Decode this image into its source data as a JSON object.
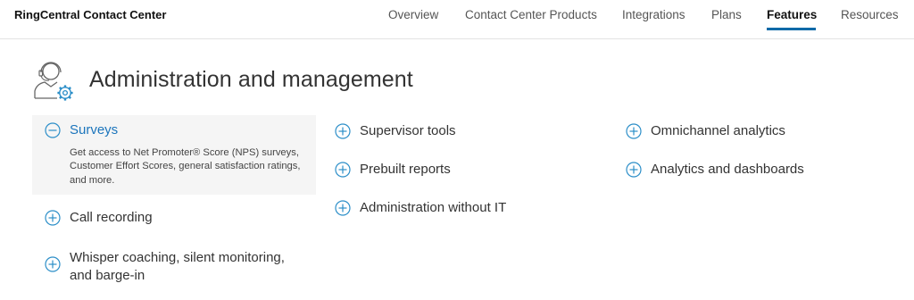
{
  "nav": {
    "brand": "RingCentral Contact Center",
    "links": [
      {
        "label": "Overview"
      },
      {
        "label": "Contact Center Products"
      },
      {
        "label": "Integrations"
      },
      {
        "label": "Plans"
      },
      {
        "label": "Features"
      },
      {
        "label": "Resources"
      }
    ],
    "active": "Features"
  },
  "section": {
    "icon": "agent-headset-gear-icon",
    "title": "Administration and management"
  },
  "columns": [
    {
      "items": [
        {
          "label": "Surveys",
          "expanded": true,
          "icon": "minus-circle-icon",
          "description": "Get access to Net Promoter® Score (NPS) surveys, Customer Effort Scores, general satisfaction ratings, and more."
        },
        {
          "label": "Call recording",
          "expanded": false,
          "icon": "plus-circle-icon"
        },
        {
          "label": "Whisper coaching, silent monitoring, and barge-in",
          "expanded": false,
          "icon": "plus-circle-icon"
        }
      ]
    },
    {
      "items": [
        {
          "label": "Supervisor tools",
          "expanded": false,
          "icon": "plus-circle-icon"
        },
        {
          "label": "Prebuilt reports",
          "expanded": false,
          "icon": "plus-circle-icon"
        },
        {
          "label": "Administration without IT",
          "expanded": false,
          "icon": "plus-circle-icon"
        }
      ]
    },
    {
      "items": [
        {
          "label": "Omnichannel analytics",
          "expanded": false,
          "icon": "plus-circle-icon"
        },
        {
          "label": "Analytics and dashboards",
          "expanded": false,
          "icon": "plus-circle-icon"
        }
      ]
    }
  ],
  "colors": {
    "accent": "#1c75bc",
    "nav_underline": "#0b6aa8",
    "panel_bg": "#f5f5f5",
    "icon_stroke": "#2b8ec8"
  }
}
